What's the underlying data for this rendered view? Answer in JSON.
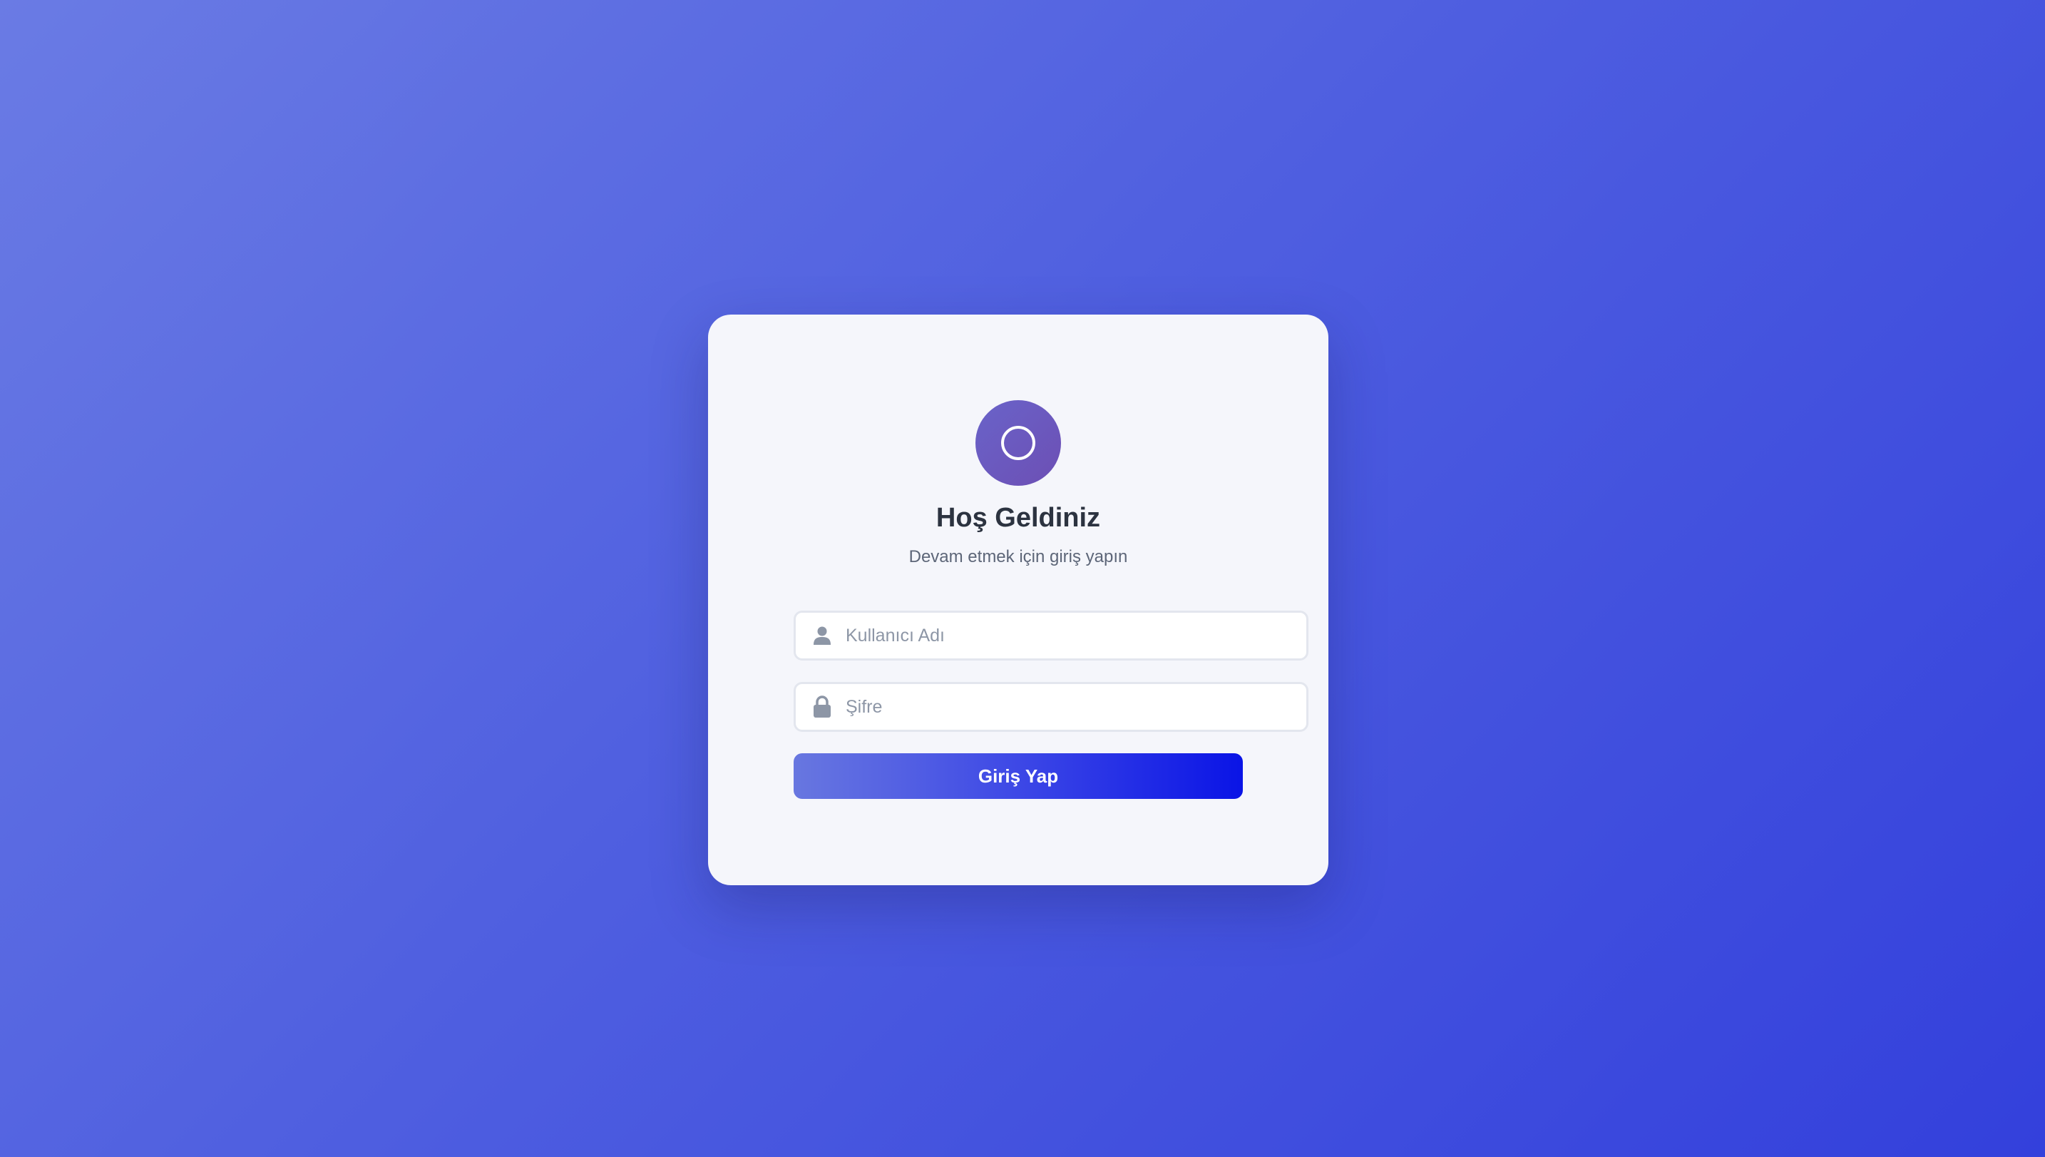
{
  "login": {
    "logo_icon": "circle-logo-icon",
    "title": "Hoş Geldiniz",
    "subtitle": "Devam etmek için giriş yapın",
    "username": {
      "icon": "user-icon",
      "placeholder": "Kullanıcı Adı",
      "value": ""
    },
    "password": {
      "icon": "lock-icon",
      "placeholder": "Şifre",
      "value": ""
    },
    "submit_label": "Giriş Yap"
  },
  "colors": {
    "background_start": "#6a7be4",
    "background_end": "#3340dc",
    "card_background": "#f5f6fb",
    "logo_gradient_start": "#6a63c9",
    "logo_gradient_end": "#6c4fb4",
    "button_gradient_start": "#6877e0",
    "button_gradient_end": "#0a14e6",
    "title_text": "#2c3340",
    "subtitle_text": "#5d6678",
    "placeholder_text": "#8d96a6"
  }
}
